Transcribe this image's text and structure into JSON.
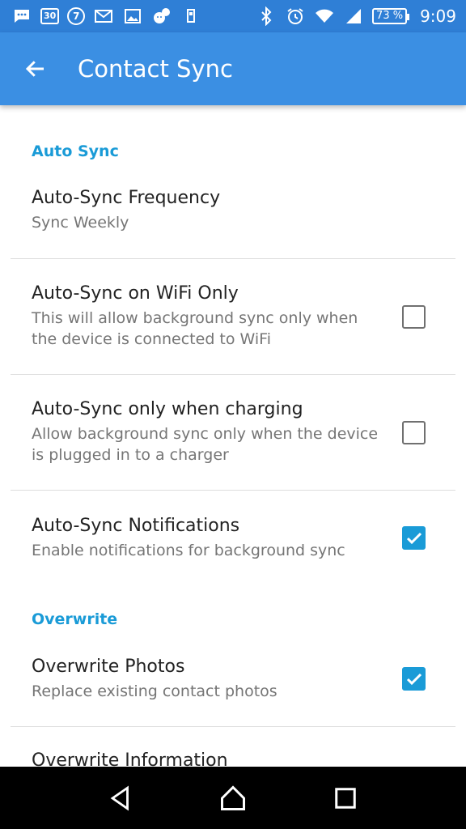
{
  "status_bar": {
    "calendar_day": "30",
    "circle_num": "7",
    "battery": "73 %",
    "time": "9:09"
  },
  "app_bar": {
    "title": "Contact Sync"
  },
  "sections": {
    "auto_sync": {
      "header": "Auto Sync",
      "frequency": {
        "title": "Auto-Sync Frequency",
        "summary": "Sync Weekly"
      },
      "wifi_only": {
        "title": "Auto-Sync on WiFi Only",
        "summary": "This will allow background sync only when the device is connected to WiFi",
        "checked": false
      },
      "charging": {
        "title": "Auto-Sync only when charging",
        "summary": "Allow background sync only when the device is plugged in to a charger",
        "checked": false
      },
      "notifications": {
        "title": "Auto-Sync Notifications",
        "summary": "Enable notifications for background sync",
        "checked": true
      }
    },
    "overwrite": {
      "header": "Overwrite",
      "photos": {
        "title": "Overwrite Photos",
        "summary": "Replace existing contact photos",
        "checked": true
      },
      "information": {
        "title": "Overwrite Information"
      }
    }
  },
  "colors": {
    "app_bar": "#3b8fe3",
    "status_bar": "#2f7fd6",
    "accent": "#1a9bd7"
  }
}
